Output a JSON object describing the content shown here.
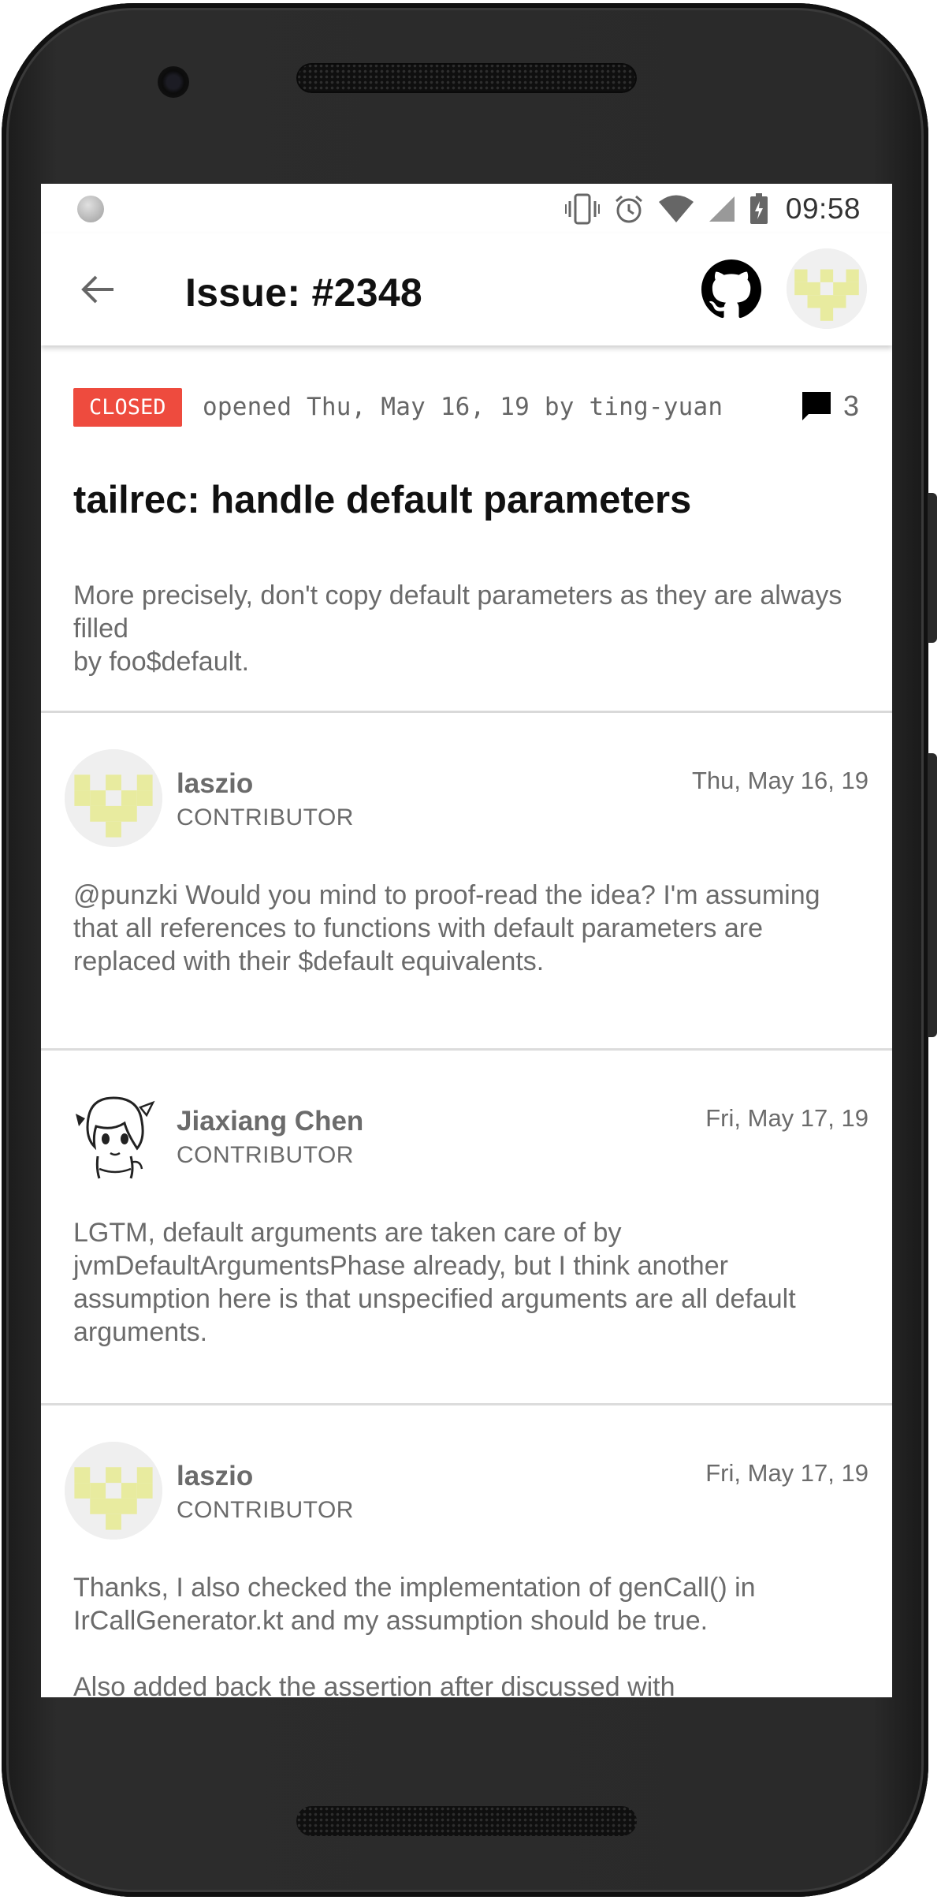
{
  "status_bar": {
    "time": "09:58",
    "icons": [
      "notification-dot-icon",
      "vibrate-icon",
      "alarm-icon",
      "wifi-icon",
      "signal-icon",
      "battery-icon"
    ]
  },
  "toolbar": {
    "back_icon": "arrow-back-icon",
    "title": "Issue: #2348",
    "github_icon": "github-icon"
  },
  "issue": {
    "state": "CLOSED",
    "state_color": "#ee4b3e",
    "opened_line": "opened Thu, May 16, 19 by ting-yuan",
    "comment_count": "3",
    "title": "tailrec: handle default parameters",
    "body": "More precisely, don't copy default parameters as they are always filled\nby foo$default."
  },
  "comments": [
    {
      "author": "laszio",
      "role": "CONTRIBUTOR",
      "date": "Thu, May 16, 19",
      "body": "@punzki Would you mind to proof-read the idea? I'm assuming that all references to functions with default parameters are replaced with their $default equivalents."
    },
    {
      "author": "Jiaxiang Chen",
      "role": "CONTRIBUTOR",
      "date": "Fri, May 17, 19",
      "body": "LGTM, default arguments are taken care of by jvmDefaultArgumentsPhase already, but I think another assumption here is that unspecified arguments are all default arguments."
    },
    {
      "author": "laszio",
      "role": "CONTRIBUTOR",
      "date": "Fri, May 17, 19",
      "body": "Thanks, I also checked the implementation of genCall() in IrCallGenerator.kt and my assumption should be true.\n\nAlso added back the assertion after discussed with"
    }
  ],
  "colors": {
    "identicon": "#e8eb9f",
    "avatar_bg": "#f0f0f0",
    "text_secondary": "#6b6b6b"
  }
}
